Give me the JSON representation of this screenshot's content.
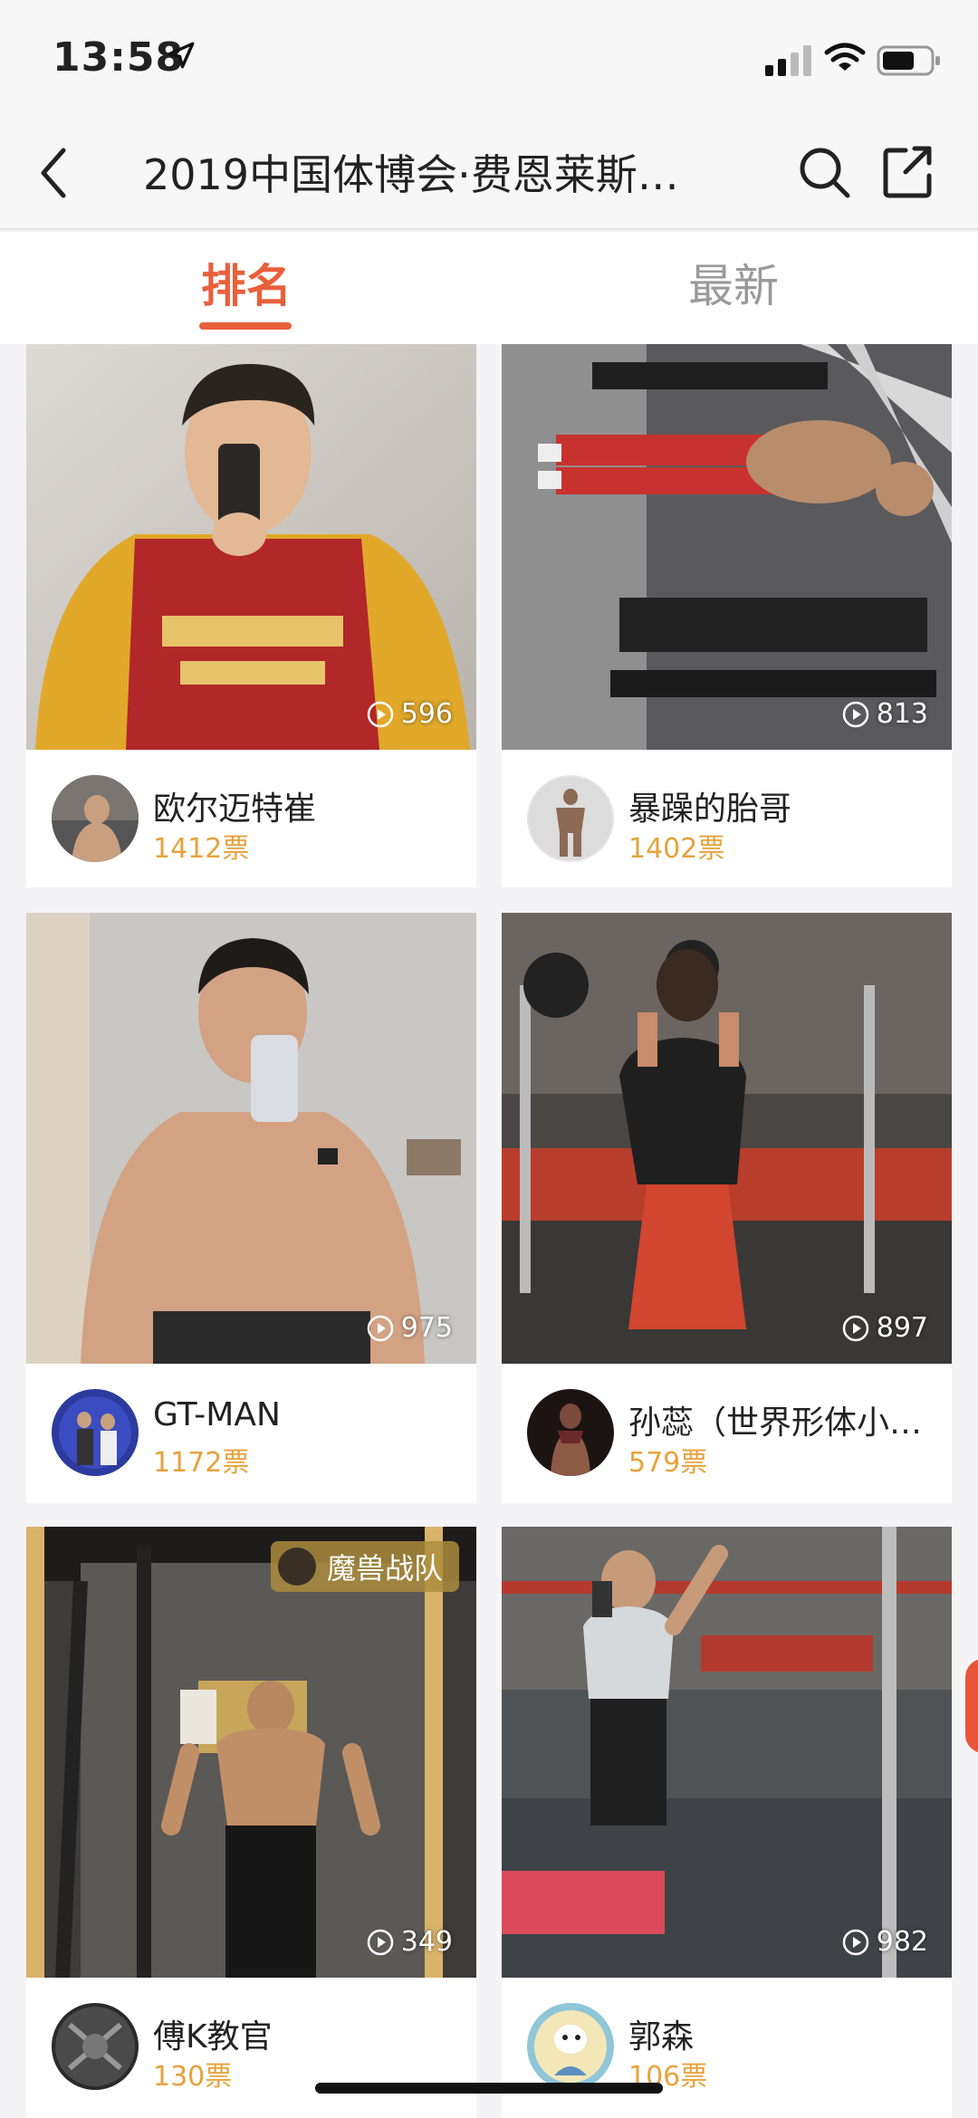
{
  "status_bar": {
    "time": "13:58"
  },
  "nav": {
    "title": "2019中国体博会·费恩莱斯…"
  },
  "tabs": [
    {
      "label": "排名"
    },
    {
      "label": "最新"
    }
  ],
  "cards": [
    {
      "plays": "596",
      "name": "欧尔迈特崔",
      "votes": "1412票"
    },
    {
      "plays": "813",
      "name": "暴躁的胎哥",
      "votes": "1402票"
    },
    {
      "plays": "975",
      "name": "GT-MAN",
      "votes": "1172票"
    },
    {
      "plays": "897",
      "name": "孙蕊（世界形体小…",
      "votes": "579票"
    },
    {
      "plays": "349",
      "name": "傅K教官",
      "votes": "130票",
      "badge": "魔兽战队"
    },
    {
      "plays": "982",
      "name": "郭森",
      "votes": "106票"
    }
  ],
  "colors": {
    "accent": "#e8603c",
    "votes": "#e6a23c"
  }
}
